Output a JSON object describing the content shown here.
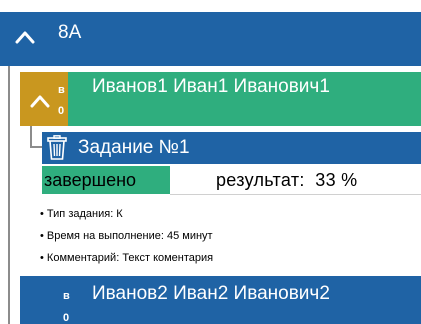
{
  "group": {
    "title": "8А",
    "icon": "chevron-up-icon"
  },
  "students": [
    {
      "name": "Иванов1 Иван1 Иванович1",
      "badge_letter": "в",
      "badge_count": "0",
      "expanded": true,
      "tasks": [
        {
          "title": "Задание №1",
          "status": "завершено",
          "result": "результат:  33 %",
          "details": [
            "Тип задания: К",
            "Время на выполнение: 45 минут",
            "Комментарий: Текст коментария"
          ]
        }
      ]
    },
    {
      "name": "Иванов2 Иван2 Иванович2",
      "badge_letter": "в",
      "badge_count": "0",
      "expanded": false
    }
  ],
  "colors": {
    "header_blue": "#1f63a5",
    "green": "#2fae7e",
    "gold": "#c9971f"
  }
}
